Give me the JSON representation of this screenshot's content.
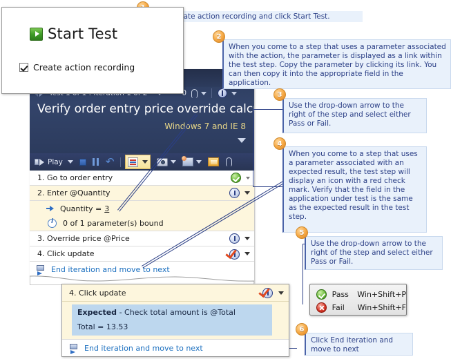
{
  "start_test_dialog": {
    "button_label": "Start Test",
    "checkbox_label": "Create action recording",
    "play_icon": "play-icon",
    "checkbox_checked": true
  },
  "runner": {
    "nav_text": "Test 1 of 1 : Iteration 1 of 2",
    "attachment_count": "0",
    "title": "Verify order entry price override calculations",
    "configuration": "Windows 7 and IE 8",
    "toolbar": {
      "play_label": "Play"
    },
    "steps": [
      {
        "text": "1. Go to order entry",
        "status": "pass",
        "highlight": false
      },
      {
        "text": "2. Enter @Quantity",
        "status": "pending",
        "highlight": true
      },
      {
        "text": "3. Override price @Price",
        "status": "pending",
        "highlight": false
      },
      {
        "text": "4. Click update",
        "status": "expected",
        "highlight": false
      }
    ],
    "substep_parameter": {
      "label": "Quantity =",
      "value": "3"
    },
    "substep_binding": "0 of 1 parameter(s) bound",
    "end_iteration_link": "End iteration and move to next"
  },
  "detail_popup": {
    "step_title": "4. Click update",
    "expected_label": "Expected",
    "expected_text": "- Check total amount is @Total",
    "total_line": "Total = 13.53",
    "end_iteration_link": "End iteration and move to next"
  },
  "pass_fail_menu": {
    "pass_label": "Pass",
    "pass_shortcut": "Win+Shift+P",
    "fail_label": "Fail",
    "fail_shortcut": "Win+Shift+F"
  },
  "callouts": [
    {
      "number": "1",
      "text": "Select Create action recording and click Start Test."
    },
    {
      "number": "2",
      "text": "When you come to a step that uses a parameter associated with the action, the parameter is displayed as a link within the test step. Copy the parameter by clicking its link. You can then copy it into the appropriate field in the application."
    },
    {
      "number": "3",
      "text": "Use the drop-down arrow to the right of the step and select either Pass or Fail."
    },
    {
      "number": "4",
      "text": "When you come to a step that uses a parameter associated with an expected result, the test step will display an icon with a red check mark. Verify that the field in the application under test is the same as the expected result in the test step."
    },
    {
      "number": "5",
      "text": "Use the drop-down arrow to the right of the step and select either Pass or Fail."
    },
    {
      "number": "6",
      "text": "Click End iteration and move to next"
    }
  ],
  "colors": {
    "callout_bg": "#e9f1fb",
    "callout_text": "#2b3f86",
    "badge": "#f5a742",
    "runner_header": "#2d3c5e",
    "highlight_row": "#fdf6dd",
    "expected_block": "#bdd7ee",
    "link": "#1b6fbf",
    "config_text": "#e9d88a"
  }
}
